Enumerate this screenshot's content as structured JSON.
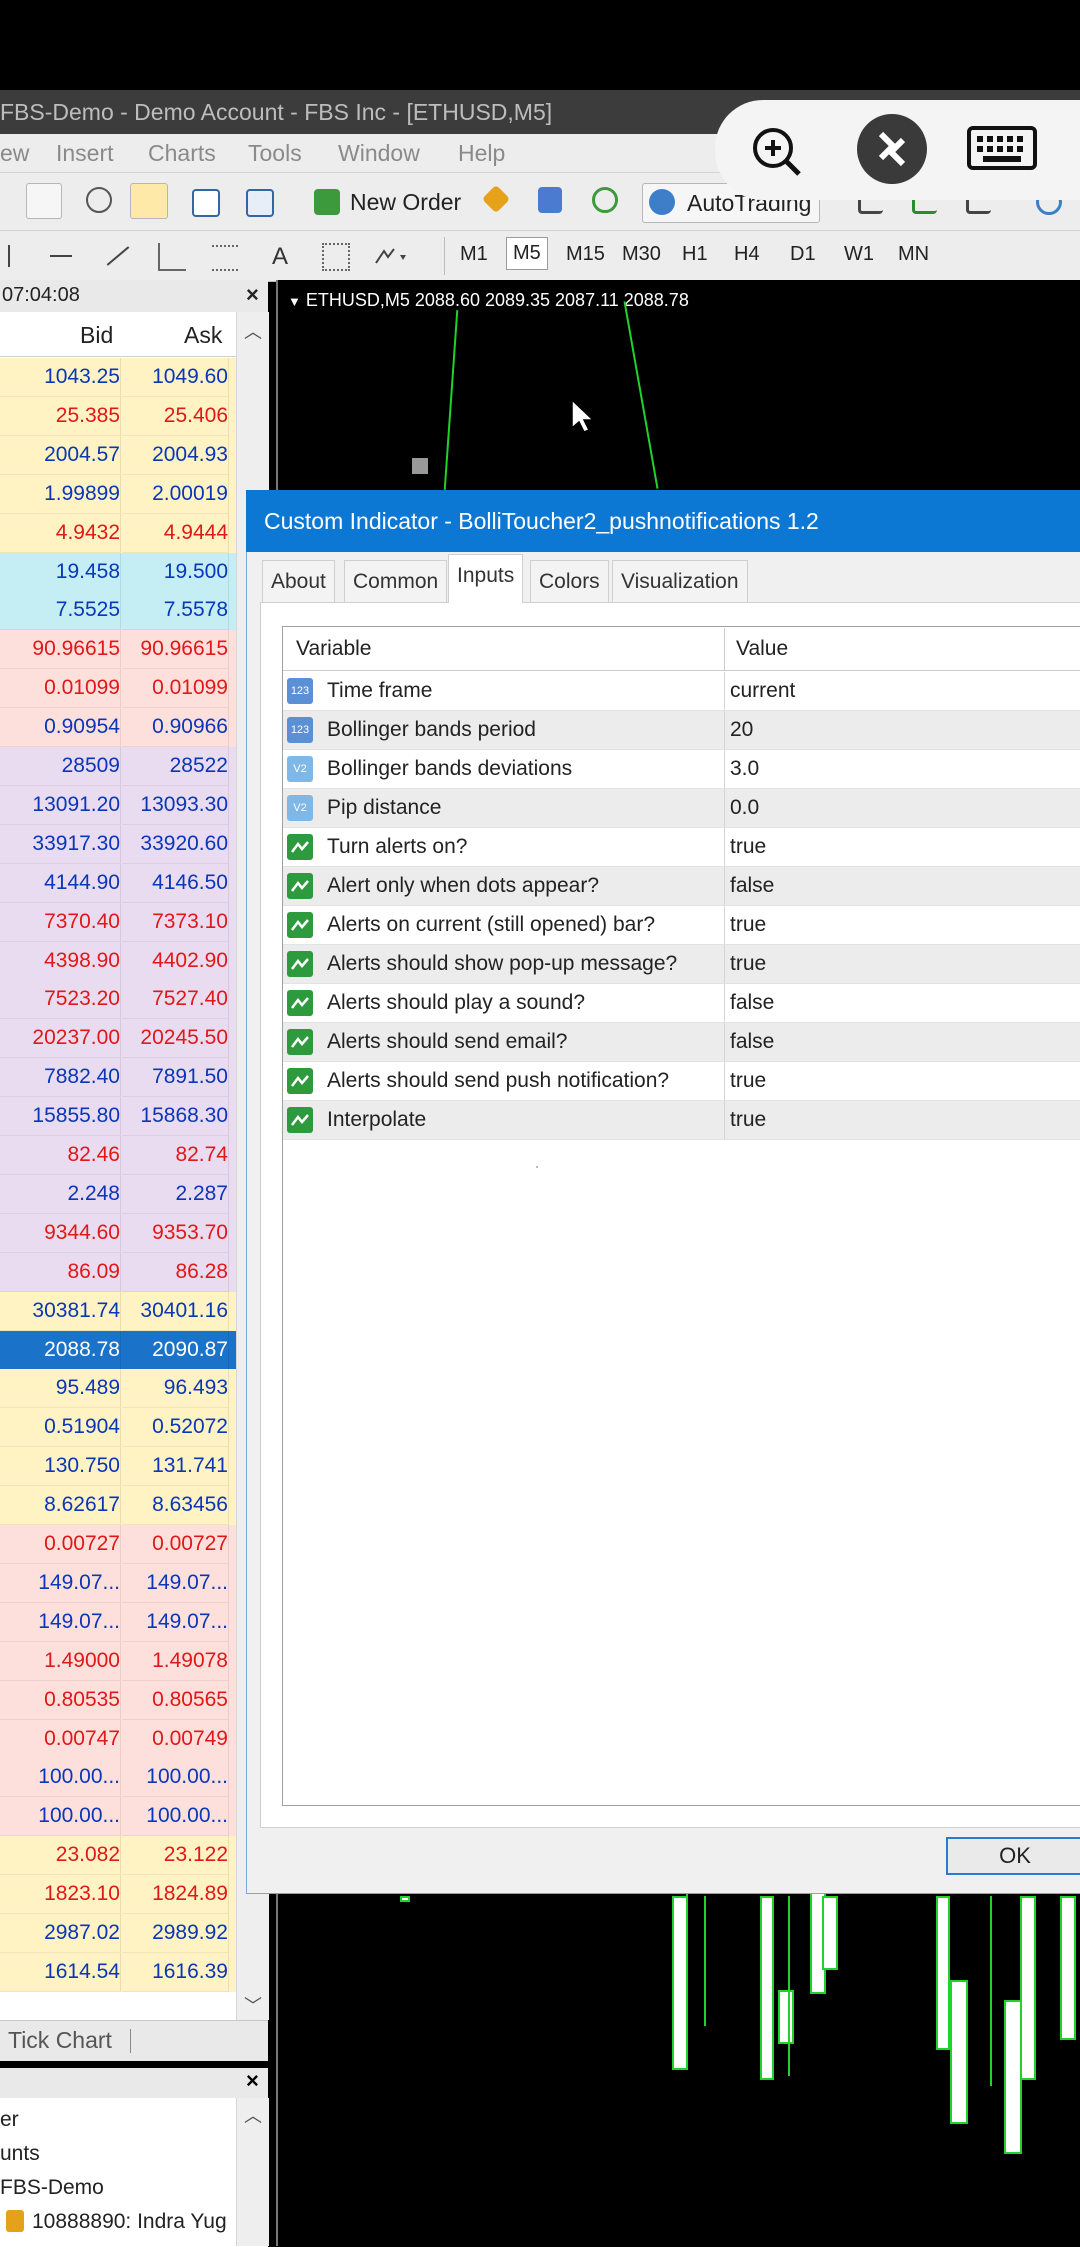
{
  "window": {
    "title": "FBS-Demo - Demo Account - FBS Inc - [ETHUSD,M5]",
    "menu": [
      "ew",
      "Insert",
      "Charts",
      "Tools",
      "Window",
      "Help"
    ]
  },
  "toolbar": {
    "new_order": "New Order",
    "auto_trading": "AutoTrading",
    "timeframes": [
      "M1",
      "M5",
      "M15",
      "M30",
      "H1",
      "H4",
      "D1",
      "W1",
      "MN"
    ],
    "selected_timeframe": "M5",
    "draw_text": "A"
  },
  "market_watch": {
    "time": "07:04:08",
    "col_bid": "Bid",
    "col_ask": "Ask",
    "rows": [
      {
        "bid": "1043.25",
        "ask": "1049.60",
        "color": "#0a36b8",
        "bg": "#fff3c4"
      },
      {
        "bid": "25.385",
        "ask": "25.406",
        "color": "#e01818",
        "bg": "#fff3c4"
      },
      {
        "bid": "2004.57",
        "ask": "2004.93",
        "color": "#0a36b8",
        "bg": "#fff3c4"
      },
      {
        "bid": "1.99899",
        "ask": "2.00019",
        "color": "#0a36b8",
        "bg": "#fff3c4"
      },
      {
        "bid": "4.9432",
        "ask": "4.9444",
        "color": "#e01818",
        "bg": "#fff3c4"
      },
      {
        "bid": "19.458",
        "ask": "19.500",
        "color": "#0a36b8",
        "bg": "#c5eef4"
      },
      {
        "bid": "7.5525",
        "ask": "7.5578",
        "color": "#0a36b8",
        "bg": "#c5eef4"
      },
      {
        "bid": "90.96615",
        "ask": "90.96615",
        "color": "#e01818",
        "bg": "#fde0dc"
      },
      {
        "bid": "0.01099",
        "ask": "0.01099",
        "color": "#e01818",
        "bg": "#fde0dc"
      },
      {
        "bid": "0.90954",
        "ask": "0.90966",
        "color": "#0a36b8",
        "bg": "#fde0dc"
      },
      {
        "bid": "28509",
        "ask": "28522",
        "color": "#0a36b8",
        "bg": "#eadcf0"
      },
      {
        "bid": "13091.20",
        "ask": "13093.30",
        "color": "#0a36b8",
        "bg": "#eadcf0"
      },
      {
        "bid": "33917.30",
        "ask": "33920.60",
        "color": "#0a36b8",
        "bg": "#eadcf0"
      },
      {
        "bid": "4144.90",
        "ask": "4146.50",
        "color": "#0a36b8",
        "bg": "#eadcf0"
      },
      {
        "bid": "7370.40",
        "ask": "7373.10",
        "color": "#e01818",
        "bg": "#eadcf0"
      },
      {
        "bid": "4398.90",
        "ask": "4402.90",
        "color": "#e01818",
        "bg": "#eadcf0"
      },
      {
        "bid": "7523.20",
        "ask": "7527.40",
        "color": "#e01818",
        "bg": "#eadcf0"
      },
      {
        "bid": "20237.00",
        "ask": "20245.50",
        "color": "#e01818",
        "bg": "#eadcf0"
      },
      {
        "bid": "7882.40",
        "ask": "7891.50",
        "color": "#0a36b8",
        "bg": "#eadcf0"
      },
      {
        "bid": "15855.80",
        "ask": "15868.30",
        "color": "#0a36b8",
        "bg": "#eadcf0"
      },
      {
        "bid": "82.46",
        "ask": "82.74",
        "color": "#e01818",
        "bg": "#eadcf0"
      },
      {
        "bid": "2.248",
        "ask": "2.287",
        "color": "#0a36b8",
        "bg": "#eadcf0"
      },
      {
        "bid": "9344.60",
        "ask": "9353.70",
        "color": "#e01818",
        "bg": "#eadcf0"
      },
      {
        "bid": "86.09",
        "ask": "86.28",
        "color": "#e01818",
        "bg": "#eadcf0"
      },
      {
        "bid": "30381.74",
        "ask": "30401.16",
        "color": "#0a36b8",
        "bg": "#fff3c4"
      },
      {
        "bid": "2088.78",
        "ask": "2090.87",
        "color": "#ffffff",
        "bg": "#1a73c8"
      },
      {
        "bid": "95.489",
        "ask": "96.493",
        "color": "#0a36b8",
        "bg": "#fff3c4"
      },
      {
        "bid": "0.51904",
        "ask": "0.52072",
        "color": "#0a36b8",
        "bg": "#fff3c4"
      },
      {
        "bid": "130.750",
        "ask": "131.741",
        "color": "#0a36b8",
        "bg": "#fff3c4"
      },
      {
        "bid": "8.62617",
        "ask": "8.63456",
        "color": "#0a36b8",
        "bg": "#fff3c4"
      },
      {
        "bid": "0.00727",
        "ask": "0.00727",
        "color": "#e01818",
        "bg": "#fde0dc"
      },
      {
        "bid": "149.07...",
        "ask": "149.07...",
        "color": "#0a36b8",
        "bg": "#fde0dc"
      },
      {
        "bid": "149.07...",
        "ask": "149.07...",
        "color": "#0a36b8",
        "bg": "#fde0dc"
      },
      {
        "bid": "1.49000",
        "ask": "1.49078",
        "color": "#e01818",
        "bg": "#fde0dc"
      },
      {
        "bid": "0.80535",
        "ask": "0.80565",
        "color": "#e01818",
        "bg": "#fde0dc"
      },
      {
        "bid": "0.00747",
        "ask": "0.00749",
        "color": "#e01818",
        "bg": "#fde0dc"
      },
      {
        "bid": "100.00...",
        "ask": "100.00...",
        "color": "#0a36b8",
        "bg": "#fde0dc"
      },
      {
        "bid": "100.00...",
        "ask": "100.00...",
        "color": "#0a36b8",
        "bg": "#fde0dc"
      },
      {
        "bid": "23.082",
        "ask": "23.122",
        "color": "#e01818",
        "bg": "#fff3c4"
      },
      {
        "bid": "1823.10",
        "ask": "1824.89",
        "color": "#e01818",
        "bg": "#fff3c4"
      },
      {
        "bid": "2987.02",
        "ask": "2989.92",
        "color": "#0a36b8",
        "bg": "#fff3c4"
      },
      {
        "bid": "1614.54",
        "ask": "1616.39",
        "color": "#0a36b8",
        "bg": "#fff3c4"
      }
    ],
    "tab_tick_chart": "Tick Chart"
  },
  "navigator": {
    "items": [
      "er",
      "unts",
      "FBS-Demo",
      "10888890: Indra Yug"
    ]
  },
  "chart": {
    "label": "ETHUSD,M5  2088.60 2089.35 2087.11 2088.78"
  },
  "dialog": {
    "title": "Custom Indicator - BolliToucher2_pushnotifications 1.2",
    "tabs": [
      "About",
      "Common",
      "Inputs",
      "Colors",
      "Visualization"
    ],
    "active_tab": "Inputs",
    "col_variable": "Variable",
    "col_value": "Value",
    "inputs": [
      {
        "type": "int",
        "name": "Time frame",
        "value": "current"
      },
      {
        "type": "int",
        "name": "Bollinger bands period",
        "value": "20"
      },
      {
        "type": "double",
        "name": "Bollinger bands deviations",
        "value": "3.0"
      },
      {
        "type": "double",
        "name": "Pip distance",
        "value": "0.0"
      },
      {
        "type": "bool",
        "name": "Turn alerts on?",
        "value": "true"
      },
      {
        "type": "bool",
        "name": "Alert only when dots appear?",
        "value": "false"
      },
      {
        "type": "bool",
        "name": "Alerts on current (still opened) bar?",
        "value": "true"
      },
      {
        "type": "bool",
        "name": "Alerts should show pop-up message?",
        "value": "true"
      },
      {
        "type": "bool",
        "name": "Alerts should play a sound?",
        "value": "false"
      },
      {
        "type": "bool",
        "name": "Alerts should send email?",
        "value": "false"
      },
      {
        "type": "bool",
        "name": "Alerts should send push notification?",
        "value": "true"
      },
      {
        "type": "bool",
        "name": "Interpolate",
        "value": "true"
      }
    ],
    "icon_labels": {
      "int": "123",
      "double": "V2"
    },
    "ok_label": "OK"
  }
}
